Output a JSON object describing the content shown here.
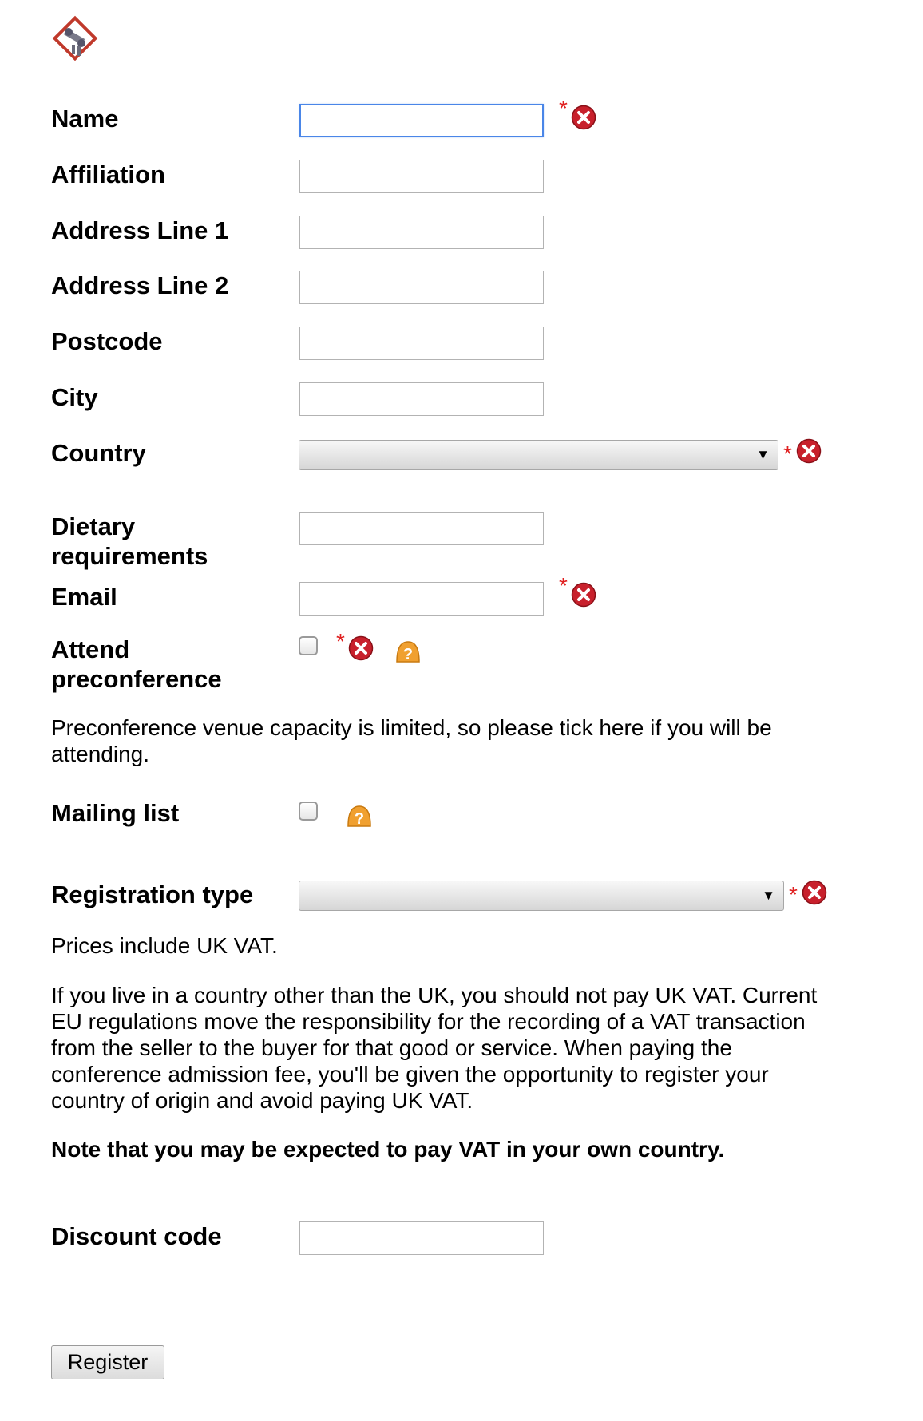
{
  "logo": {
    "icon": "conference-logo-icon"
  },
  "fields": {
    "name": {
      "label": "Name",
      "value": "",
      "required_mark": "*"
    },
    "affiliation": {
      "label": "Affiliation",
      "value": ""
    },
    "address1": {
      "label": "Address Line 1",
      "value": ""
    },
    "address2": {
      "label": "Address Line 2",
      "value": ""
    },
    "postcode": {
      "label": "Postcode",
      "value": ""
    },
    "city": {
      "label": "City",
      "value": ""
    },
    "country": {
      "label": "Country",
      "selected": "",
      "required_mark": "*"
    },
    "dietary": {
      "label": "Dietary requirements",
      "value": ""
    },
    "email": {
      "label": "Email",
      "value": "",
      "required_mark": "*"
    },
    "preconference": {
      "label": "Attend preconference",
      "checked": false,
      "required_mark": "*"
    },
    "mailing_list": {
      "label": "Mailing list",
      "checked": false
    },
    "registration_type": {
      "label": "Registration type",
      "selected": "",
      "required_mark": "*"
    },
    "discount": {
      "label": "Discount code",
      "value": ""
    }
  },
  "notes": {
    "preconference": "Preconference venue capacity is limited, so please tick here if you will be attending.",
    "vat_include": "Prices include UK VAT.",
    "vat_detail": "If you live in a country other than the UK, you should not pay UK VAT. Current EU regulations move the responsibility for the recording of a VAT transaction from the seller to the buyer for that good or service. When paying the conference admission fee, you'll be given the opportunity to register your country of origin and avoid paying UK VAT.",
    "vat_warning": "Note that you may be expected to pay VAT in your own country."
  },
  "register_button": {
    "label": "Register"
  },
  "colors": {
    "required": "#e02020",
    "error": "#c8202c",
    "help": "#f0a030",
    "focus": "#4a86e8"
  }
}
